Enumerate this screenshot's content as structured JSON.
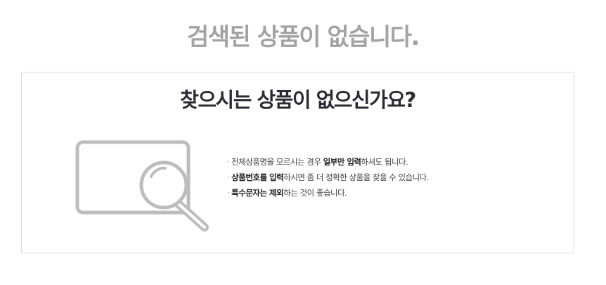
{
  "headline": "검색된 상품이 없습니다.",
  "box": {
    "title": "찾으시는 상품이 없으신가요?",
    "illustration_icon": "search-magnifier-card-icon",
    "tips": [
      {
        "bullet": "·",
        "parts": [
          "전체상품명을 모르시는 경우 ",
          "일부만 입력",
          "하셔도 됩니다."
        ]
      },
      {
        "bullet": "·",
        "parts": [
          "",
          "상품번호를 입력",
          "하시면 좀 더 정확한 상품을 찾을 수 있습니다."
        ]
      },
      {
        "bullet": "·",
        "parts": [
          "",
          "특수문자는 제외",
          "하는 것이 좋습니다."
        ]
      }
    ]
  },
  "colors": {
    "headline": "#a3a3a3",
    "title": "#2b2b33",
    "icon": "#bdbdbd",
    "border": "#dcdcdc"
  }
}
